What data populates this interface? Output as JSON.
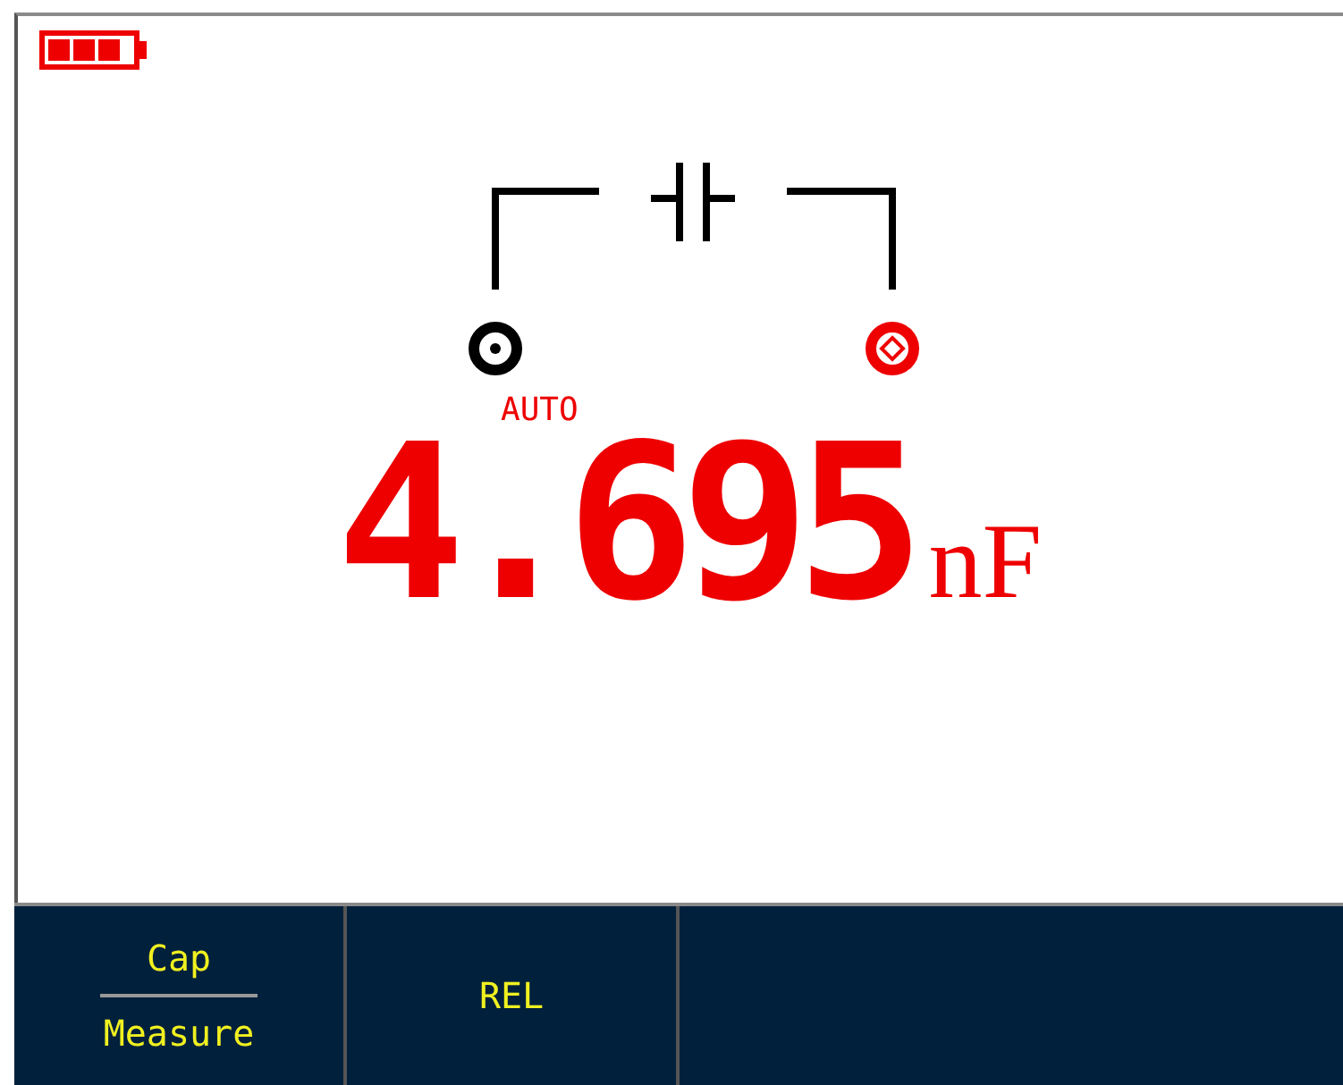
{
  "display": {
    "range_mode": "AUTO",
    "value": "4.695",
    "unit": "nF"
  },
  "softkeys": [
    {
      "kind": "split",
      "top": "Cap",
      "bottom": "Measure"
    },
    {
      "kind": "single",
      "label": "REL"
    }
  ]
}
